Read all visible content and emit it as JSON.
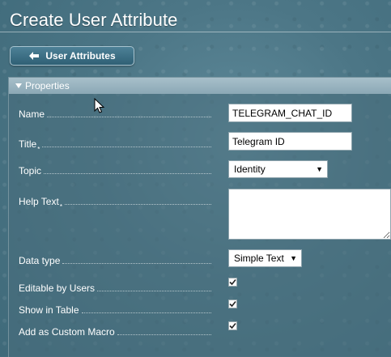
{
  "page": {
    "title": "Create User Attribute"
  },
  "toolbar": {
    "back_label": "User Attributes"
  },
  "panel": {
    "header": "Properties"
  },
  "form": {
    "name": {
      "label": "Name",
      "value": "TELEGRAM_CHAT_ID",
      "required": false
    },
    "title": {
      "label": "Title",
      "required_mark": "*",
      "value": "Telegram ID"
    },
    "topic": {
      "label": "Topic",
      "value": "Identity"
    },
    "help_text": {
      "label": "Help Text",
      "required_mark": "*",
      "value": ""
    },
    "data_type": {
      "label": "Data type",
      "value": "Simple Text"
    },
    "editable_by_users": {
      "label": "Editable by Users",
      "checked": true
    },
    "show_in_table": {
      "label": "Show in Table",
      "checked": true
    },
    "add_as_custom_macro": {
      "label": "Add as Custom Macro",
      "checked": true
    }
  },
  "icons": {
    "back": "arrow-left-icon",
    "collapse": "triangle-down-icon",
    "checkmark": "checkmark-icon",
    "cursor": "mouse-pointer-icon"
  },
  "colors": {
    "background": "#4c7686",
    "panel_header": "#9bb5c1",
    "button": "#3a6d82",
    "text": "#ffffff"
  }
}
